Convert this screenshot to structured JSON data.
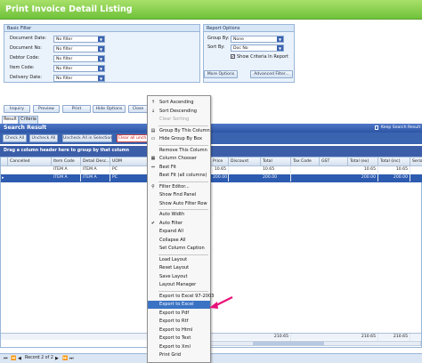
{
  "window": {
    "title": "Print Invoice Detail Listing"
  },
  "basic_filter": {
    "title": "Basic Filter",
    "fields": [
      {
        "label": "Document Date:",
        "value": "No filter"
      },
      {
        "label": "Document No:",
        "value": "No filter"
      },
      {
        "label": "Debtor Code:",
        "value": "No filter"
      },
      {
        "label": "Item Code:",
        "value": "No filter"
      },
      {
        "label": "Delivery Date:",
        "value": "No filter"
      }
    ]
  },
  "report_options": {
    "title": "Report Options",
    "group_by_label": "Group By:",
    "group_by_value": "None",
    "sort_by_label": "Sort By:",
    "sort_by_value": "Doc No",
    "show_criteria_label": "Show Criteria In Report",
    "more_options_label": "More Options",
    "advanced_filter_label": "Advanced Filter..."
  },
  "toolbar": {
    "inquiry": "Inquiry",
    "preview": "Preview",
    "print": "Print",
    "hide_options": "Hide Options",
    "close": "Close"
  },
  "tabs": {
    "result": "Result",
    "criteria": "Criteria"
  },
  "search_result": {
    "title": "Search Result",
    "keep_label": "Keep Search Result",
    "check_all": "Check All",
    "uncheck_all": "Uncheck All",
    "uncheck_selection": "Uncheck All in Selection",
    "clear_all": "Clear all unch"
  },
  "grid": {
    "group_hint": "Drag a column header here to group by that column",
    "columns": [
      "Cancelled",
      "Item Code",
      "Detail Desc...",
      "UOM",
      "Price",
      "Discount",
      "Total",
      "Tax Code",
      "GST",
      "Total (ex)",
      "Total (inc)",
      "Serial"
    ],
    "rows": [
      [
        "",
        "ITEM A",
        "ITEM A",
        "PC",
        "10.65",
        "",
        "10.65",
        "",
        "",
        "10.65",
        "10.65",
        ""
      ],
      [
        "",
        "ITEM A",
        "ITEM A",
        "PC",
        "200.00",
        "",
        "200.00",
        "",
        "",
        "200.00",
        "200.00",
        ""
      ]
    ],
    "footer_total": "210.65",
    "footer_total_ex": "210.65",
    "footer_total_inc": "210.65",
    "record_label": "Record 2 of 2"
  },
  "context_menu": {
    "items": [
      {
        "label": "Sort Ascending",
        "icon": "sort-ascending-icon",
        "glyph": "↑"
      },
      {
        "label": "Sort Descending",
        "icon": "sort-descending-icon",
        "glyph": "↓"
      },
      {
        "label": "Clear Sorting",
        "disabled": true
      },
      {
        "label": "Group By This Column",
        "icon": "group-by-icon",
        "glyph": "▤"
      },
      {
        "label": "Hide Group By Box",
        "icon": "group-box-icon",
        "glyph": "▭"
      },
      {
        "label": "Remove This Column"
      },
      {
        "label": "Column Chooser",
        "icon": "column-chooser-icon",
        "glyph": "▦"
      },
      {
        "label": "Best Fit",
        "icon": "best-fit-icon",
        "glyph": "⇔"
      },
      {
        "label": "Best Fit (all columns)"
      },
      {
        "label": "Filter Editor...",
        "icon": "filter-editor-icon",
        "glyph": "⚲"
      },
      {
        "label": "Show Find Panel"
      },
      {
        "label": "Show Auto Filter Row"
      },
      {
        "label": "Auto Width"
      },
      {
        "label": "Auto Filter",
        "icon": "check-icon",
        "glyph": "✔"
      },
      {
        "label": "Expand All"
      },
      {
        "label": "Collapse All"
      },
      {
        "label": "Set Column Caption"
      },
      {
        "label": "Load Layout"
      },
      {
        "label": "Reset Layout"
      },
      {
        "label": "Save Layout"
      },
      {
        "label": "Layout Manager"
      },
      {
        "label": "Export to Excel 97-2003"
      },
      {
        "label": "Export to Excel",
        "highlighted": true
      },
      {
        "label": "Export to Pdf"
      },
      {
        "label": "Export to Rtf"
      },
      {
        "label": "Export to Html"
      },
      {
        "label": "Export to Text"
      },
      {
        "label": "Export to Xml"
      },
      {
        "label": "Print Grid"
      }
    ]
  },
  "colors": {
    "title_green": "#6fc23a",
    "accent_blue": "#3a63b0",
    "highlight": "#3b73c4",
    "arrow": "#e8127a"
  }
}
